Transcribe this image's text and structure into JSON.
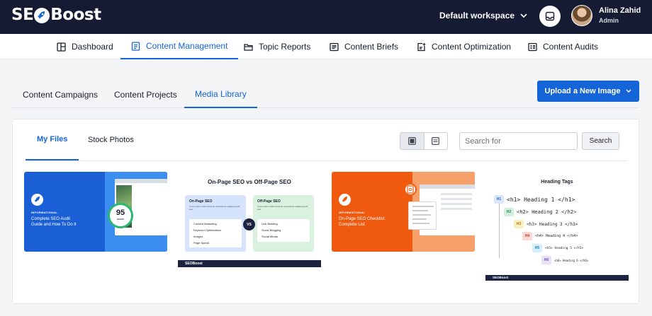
{
  "brand": {
    "logo_pre": "SE",
    "logo_post": "Boost",
    "accent": "#1565d8",
    "topbar_bg": "#141b33"
  },
  "topbar": {
    "workspace": "Default workspace",
    "user_name": "Alina Zahid",
    "user_role": "Admin"
  },
  "nav": {
    "items": [
      {
        "label": "Dashboard",
        "icon": "layout-icon"
      },
      {
        "label": "Content Management",
        "icon": "document-list-icon",
        "active": true
      },
      {
        "label": "Topic Reports",
        "icon": "folder-icon"
      },
      {
        "label": "Content Briefs",
        "icon": "brief-icon"
      },
      {
        "label": "Content Optimization",
        "icon": "edit-doc-icon"
      },
      {
        "label": "Content Audits",
        "icon": "audit-icon"
      }
    ]
  },
  "subtabs": {
    "items": [
      {
        "label": "Content Campaigns"
      },
      {
        "label": "Content Projects"
      },
      {
        "label": "Media Library",
        "active": true
      }
    ],
    "upload_label": "Upload a New Image"
  },
  "library": {
    "tabs": [
      {
        "label": "My Files",
        "active": true
      },
      {
        "label": "Stock Photos"
      }
    ],
    "search_placeholder": "Search for",
    "search_label": "Search",
    "view_modes": [
      "grid-view-icon",
      "list-view-icon"
    ]
  },
  "thumbs": {
    "t1": {
      "tag": "INFORMATIONAL",
      "title_line1": "Complete SEO Audit",
      "title_line2": "Guide and How To Do It",
      "score": "95",
      "score_label": "score"
    },
    "t2": {
      "title": "On-Page SEO vs Off-Page SEO",
      "left_heading": "On-Page SEO",
      "left_items": [
        "Content Marketing",
        "Keyword Optimization",
        "Images",
        "Page Speed"
      ],
      "right_heading": "Off-Page SEO",
      "right_items": [
        "Link Building",
        "Guest Blogging",
        "Social Media"
      ],
      "vs": "VS",
      "footer_logo": "SEOBoost"
    },
    "t3": {
      "tag": "INFORMATIONAL",
      "title_line1": "On-Page SEO Checklist:",
      "title_line2": "Complete List"
    },
    "t4": {
      "title": "Heading Tags",
      "rows": [
        {
          "tag": "H1",
          "text": "<h1> Heading 1 </h1>",
          "color": "#dbe7fb"
        },
        {
          "tag": "H2",
          "text": "<h2> Heading 2 </h2>",
          "color": "#d3f0dc"
        },
        {
          "tag": "H3",
          "text": "<h3> Heading 3 </h3>",
          "color": "#fdeec0"
        },
        {
          "tag": "H4",
          "text": "<h4> Heading 4 </h4>",
          "color": "#fbd9d6"
        },
        {
          "tag": "H5",
          "text": "<h5> Heading 5 </h5>",
          "color": "#d5efff"
        },
        {
          "tag": "H6",
          "text": "<h6> Heading 6 </h6>",
          "color": "#e7e0f7"
        }
      ],
      "footer_logo": "SEOBoost"
    }
  }
}
